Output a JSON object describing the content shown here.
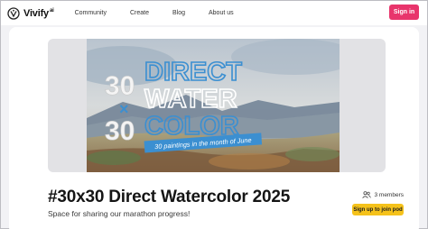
{
  "app": {
    "logo_text": "Vivify",
    "logo_suffix": "ai"
  },
  "nav": {
    "links": [
      {
        "label": "Community"
      },
      {
        "label": "Create"
      },
      {
        "label": "Blog"
      },
      {
        "label": "About us"
      }
    ],
    "signin_label": "Sign in"
  },
  "banner": {
    "number_top": "30",
    "times": "×",
    "number_bottom": "30",
    "line1": "DIRECT",
    "line2": "WATER",
    "line3": "COLOR",
    "ribbon": "30 paintings in the month of June"
  },
  "group": {
    "title": "#30x30 Direct Watercolor 2025",
    "description": "Space for sharing our marathon progress!",
    "members_label": "3 members",
    "join_label": "Sign up to join pod"
  },
  "colors": {
    "accent_pink": "#e8356c",
    "join_yellow": "#f5c21b",
    "banner_blue": "#3b8fd1"
  },
  "icons": [
    "vivify-logo-icon",
    "members-icon"
  ]
}
